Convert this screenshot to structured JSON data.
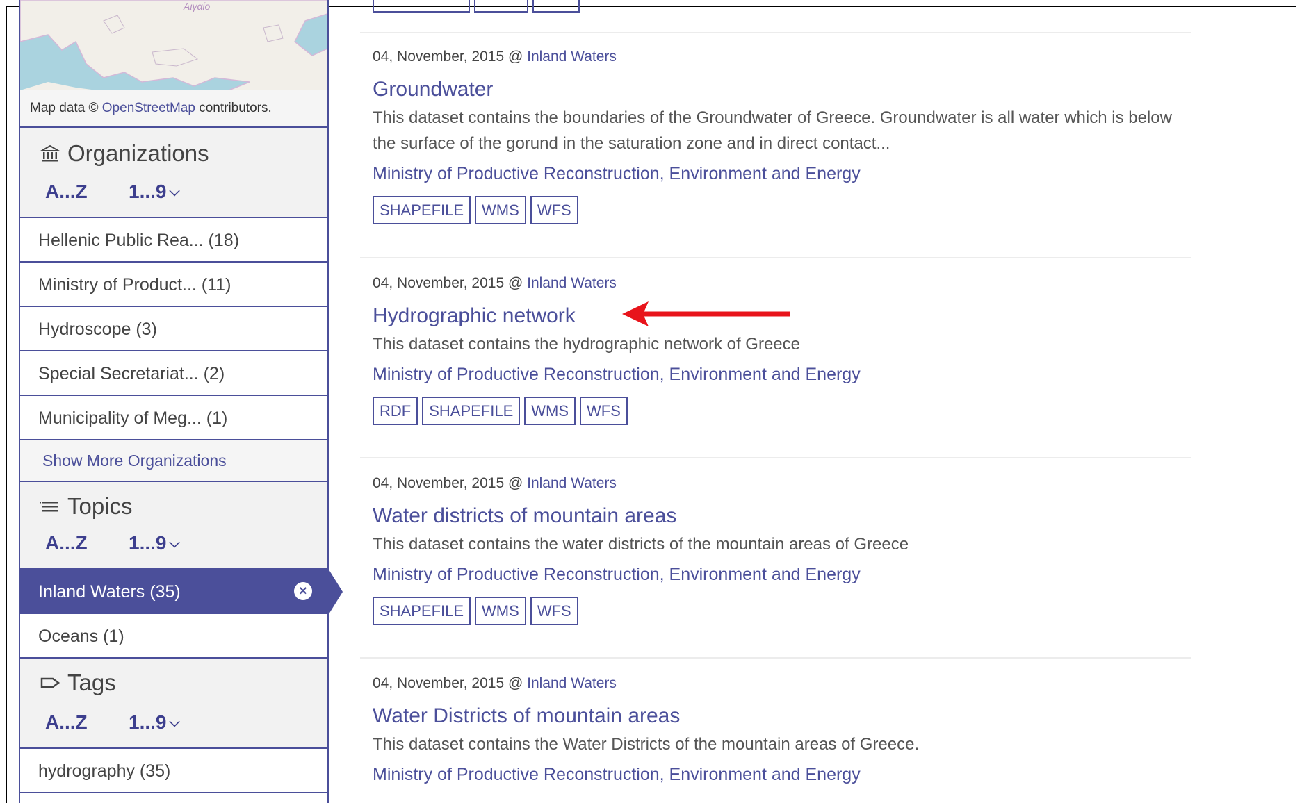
{
  "map": {
    "place_label": "Αιγαίο",
    "attribution_prefix": "Map data ©",
    "attribution_link": "OpenStreetMap",
    "attribution_suffix": "contributors."
  },
  "sort": {
    "az": "A...Z",
    "num": "1...9"
  },
  "organizations": {
    "title": "Organizations",
    "items": [
      "Hellenic Public Rea... (18)",
      "Ministry of Product... (11)",
      "Hydroscope (3)",
      "Special Secretariat... (2)",
      "Municipality of Meg... (1)"
    ],
    "show_more": "Show More Organizations"
  },
  "topics": {
    "title": "Topics",
    "items": [
      "Inland Waters (35)",
      "Oceans (1)"
    ],
    "active_clear_icon": "×"
  },
  "tags": {
    "title": "Tags",
    "items": [
      "hydrography (35)"
    ]
  },
  "datasets": [
    {
      "date": "04, November, 2015 @",
      "topic": "Inland Waters",
      "title": "Groundwater",
      "description": "This dataset contains the boundaries of the Groundwater of Greece. Groundwater is all water which is below the surface of the gorund in the saturation zone and in direct contact...",
      "organization": "Ministry of Productive Reconstruction, Environment and Energy",
      "formats": [
        "SHAPEFILE",
        "WMS",
        "WFS"
      ]
    },
    {
      "date": "04, November, 2015 @",
      "topic": "Inland Waters",
      "title": "Hydrographic network",
      "description": "This dataset contains the hydrographic network of Greece",
      "organization": "Ministry of Productive Reconstruction, Environment and Energy",
      "formats": [
        "RDF",
        "SHAPEFILE",
        "WMS",
        "WFS"
      ]
    },
    {
      "date": "04, November, 2015 @",
      "topic": "Inland Waters",
      "title": "Water districts of mountain areas",
      "description": "This dataset contains the water districts of the mountain areas of Greece",
      "organization": "Ministry of Productive Reconstruction, Environment and Energy",
      "formats": [
        "SHAPEFILE",
        "WMS",
        "WFS"
      ]
    },
    {
      "date": "04, November, 2015 @",
      "topic": "Inland Waters",
      "title": "Water Districts of mountain areas",
      "description": "This dataset contains the Water Districts of the mountain areas of Greece.",
      "organization": "Ministry of Productive Reconstruction, Environment and Energy",
      "formats": []
    }
  ],
  "colors": {
    "accent": "#4b4f9a",
    "annotation_arrow": "#e8141b",
    "map_sea": "#aad3df",
    "map_land": "#f2efe9"
  }
}
